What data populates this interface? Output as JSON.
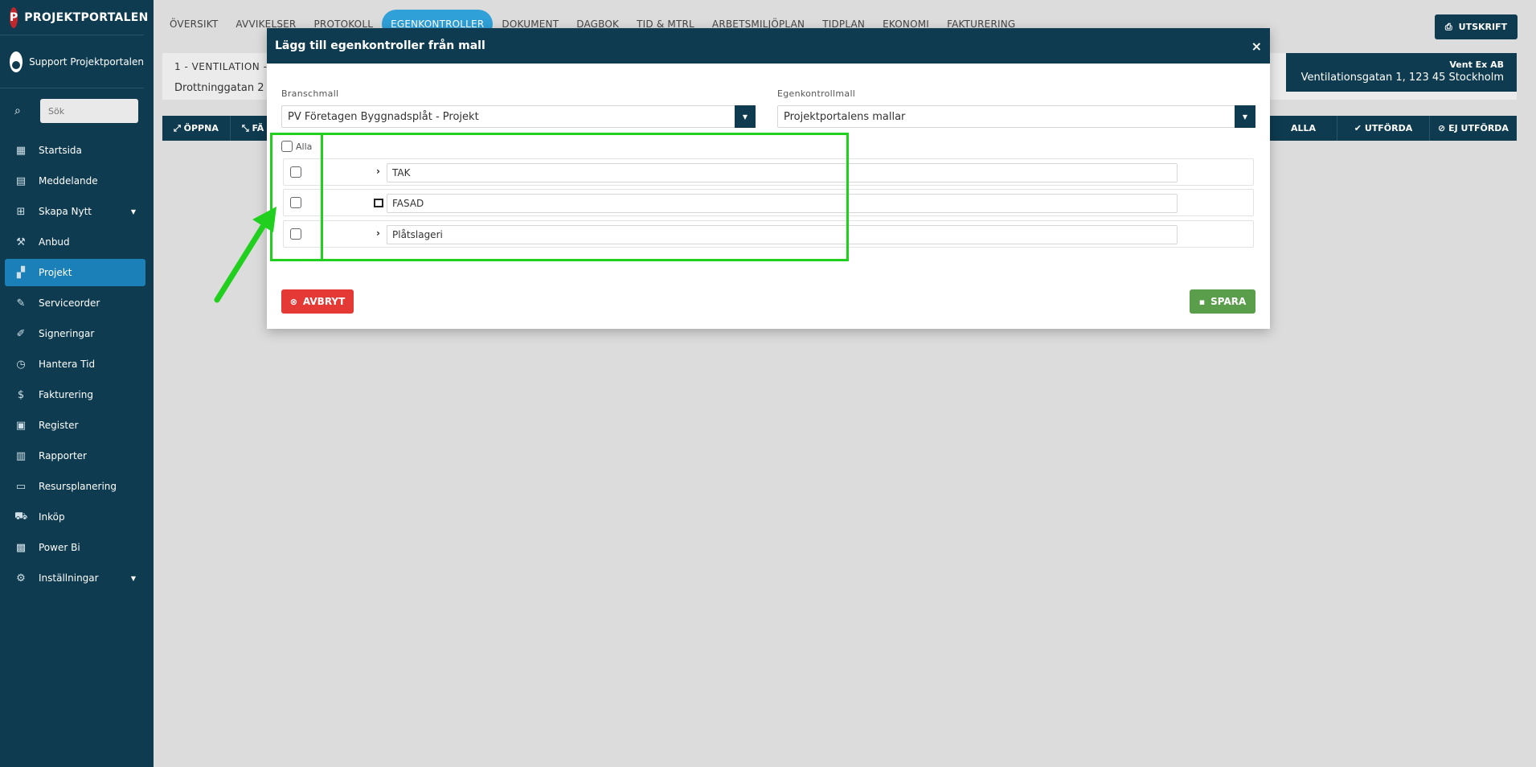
{
  "brand": {
    "name": "PROJEKTPORTALEN",
    "logo_letter": "P"
  },
  "user": {
    "name": "Support Projektportalen"
  },
  "search": {
    "placeholder": "Sök"
  },
  "sidebar": {
    "items": [
      {
        "label": "Startsida",
        "icon": "dashboard-icon"
      },
      {
        "label": "Meddelande",
        "icon": "message-icon"
      },
      {
        "label": "Skapa Nytt",
        "icon": "plus-square-icon",
        "caret": true
      },
      {
        "label": "Anbud",
        "icon": "gavel-icon"
      },
      {
        "label": "Projekt",
        "icon": "project-icon",
        "active": true
      },
      {
        "label": "Serviceorder",
        "icon": "wrench-icon"
      },
      {
        "label": "Signeringar",
        "icon": "pen-icon"
      },
      {
        "label": "Hantera Tid",
        "icon": "clock-icon"
      },
      {
        "label": "Fakturering",
        "icon": "dollar-icon"
      },
      {
        "label": "Register",
        "icon": "image-icon"
      },
      {
        "label": "Rapporter",
        "icon": "calendar-icon"
      },
      {
        "label": "Resursplanering",
        "icon": "calendar-outline-icon"
      },
      {
        "label": "Inköp",
        "icon": "cart-icon"
      },
      {
        "label": "Power Bi",
        "icon": "chart-icon"
      },
      {
        "label": "Inställningar",
        "icon": "gear-icon",
        "caret": true
      }
    ]
  },
  "topnav": {
    "tabs": [
      "ÖVERSIKT",
      "AVVIKELSER",
      "PROTOKOLL",
      "EGENKONTROLLER",
      "DOKUMENT",
      "DAGBOK",
      "TID & MTRL",
      "ARBETSMILJÖPLAN",
      "TIDPLAN",
      "EKONOMI",
      "FAKTURERING"
    ],
    "active_tab": "EGENKONTROLLER",
    "print_label": "UTSKRIFT"
  },
  "project": {
    "name": "1 - VENTILATION -",
    "address": "Drottninggatan 2",
    "company": "Vent Ex AB",
    "company_address": "Ventilationsgatan 1, 123 45 Stockholm"
  },
  "filters": {
    "open_label": "ÖPPNA",
    "collapse_label": "FÄ",
    "all_label": "ALLA",
    "done_label": "UTFÖRDA",
    "not_done_label": "EJ UTFÖRDA"
  },
  "modal": {
    "title": "Lägg till egenkontroller från mall",
    "close": "×",
    "branch_label": "Branschmall",
    "branch_value": "PV Företagen Byggnadsplåt - Projekt",
    "template_label": "Egenkontrollmall",
    "template_value": "Projektportalens mallar",
    "all_label": "Alla",
    "rows": [
      {
        "name": "TAK",
        "toggle": "›"
      },
      {
        "name": "FASAD",
        "toggle": ""
      },
      {
        "name": "Plåtslageri",
        "toggle": "›"
      }
    ],
    "cancel_label": "AVBRYT",
    "save_label": "SPARA"
  },
  "colors": {
    "primary": "#0e3b4f",
    "active_nav": "#1c80b8",
    "tab_active": "#2fa0d8",
    "cancel": "#e53935",
    "save": "#5a9e4c",
    "highlight": "#21d01e"
  }
}
